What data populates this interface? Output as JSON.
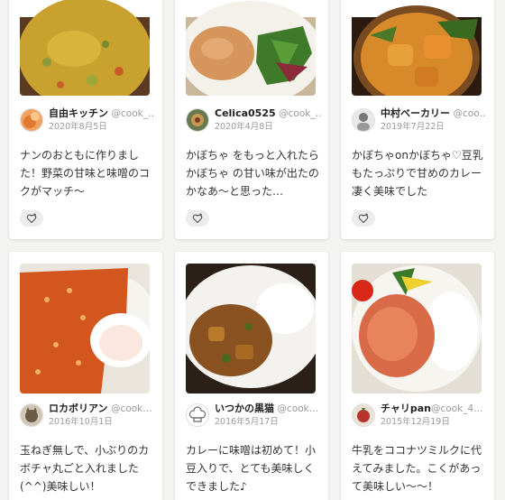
{
  "snaps": [
    {
      "author": "自由キッチン",
      "handle": "@cook_…",
      "date": "2020年8月5日",
      "comment": "ナンのおともに作りました！野菜の甘味と味噌のコクがマッチ〜",
      "photo_icon": "curry-with-vegetables-photo",
      "avatar_icon": "orange-avatar-icon",
      "like_icon": "heart-plus-icon"
    },
    {
      "author": "Celica0525",
      "handle": "@cook_…",
      "date": "2020年4月8日",
      "comment": "かぼちゃ をもっと入れたらかぼちゃ の甘い味が出たのかなあ〜と思った…",
      "photo_icon": "curry-with-salad-photo",
      "avatar_icon": "flower-avatar-icon",
      "like_icon": "heart-plus-icon"
    },
    {
      "author": "中村ベーカリー",
      "handle": "@coo…",
      "date": "2019年7月22日",
      "comment": "かぼちゃonかぼちゃ♡豆乳もたっぷりで甘めのカレー凄く美味でした",
      "photo_icon": "pumpkin-curry-bowl-photo",
      "avatar_icon": "person-avatar-icon",
      "like_icon": "heart-plus-icon"
    },
    {
      "author": "ロカボリアン",
      "handle": "@cook…",
      "date": "2016年10月1日",
      "comment": "玉ねぎ無しで、小ぶりのカボチャ丸ごと入れました(^^)美味しい！",
      "photo_icon": "keema-curry-with-egg-photo",
      "avatar_icon": "cat-avatar-icon",
      "like_icon": "heart-plus-icon"
    },
    {
      "author": "いつかの黒猫",
      "handle": "@cook…",
      "date": "2016年5月17日",
      "comment": "カレーに味噌は初めて！小豆入りで、とても美味しくできました♪",
      "photo_icon": "curry-rice-plate-photo",
      "avatar_icon": "chef-hat-avatar-icon",
      "like_icon": "heart-plus-icon"
    },
    {
      "author": "チャリpan",
      "handle": "@cook_4…",
      "date": "2015年12月19日",
      "comment": "牛乳をココナツミルクに代えてみました。こくがあって美味しい〜〜！",
      "photo_icon": "curry-with-tomato-photo",
      "avatar_icon": "red-food-avatar-icon",
      "like_icon": "heart-plus-icon"
    }
  ]
}
